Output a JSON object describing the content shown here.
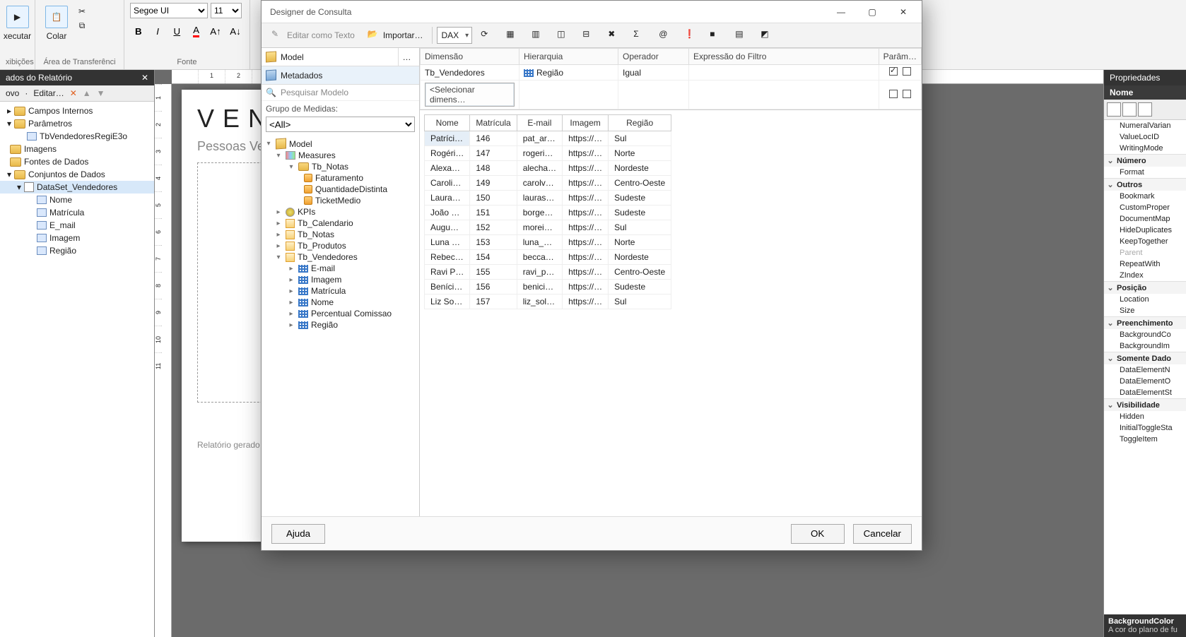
{
  "ribbon": {
    "run_label": "xecutar",
    "paste_label": "Colar",
    "group_views": "xibições",
    "group_clipboard": "Área de Transferênci",
    "group_font": "Fonte",
    "font_name": "Segoe UI",
    "font_size": "11"
  },
  "reportData": {
    "title": "ados do Relatório",
    "action_new": "ovo",
    "action_edit": "Editar…",
    "nodes": {
      "internos": "Campos Internos",
      "params": "Parâmetros",
      "param1": "TbVendedoresRegiE3o",
      "imagens": "Imagens",
      "fontes": "Fontes de Dados",
      "conjuntos": "Conjuntos de Dados",
      "ds": "DataSet_Vendedores",
      "f_nome": "Nome",
      "f_matricula": "Matrícula",
      "f_email": "E_mail",
      "f_imagem": "Imagem",
      "f_regiao": "Região"
    }
  },
  "canvas": {
    "title": "VEN",
    "subtitle": "Pessoas Ve",
    "footer": "Relatório gerado"
  },
  "dialog": {
    "title": "Designer de Consulta",
    "btn_import": "Importar…",
    "btn_editText": "Editar como Texto",
    "dax": "DAX",
    "model": "Model",
    "metadados": "Metadados",
    "search_placeholder": "Pesquisar Modelo",
    "group_label": "Grupo de Medidas:",
    "group_all": "<All>",
    "help": "Ajuda",
    "ok": "OK",
    "cancel": "Cancelar",
    "tree": {
      "model": "Model",
      "measures": "Measures",
      "tb_notas": "Tb_Notas",
      "faturamento": "Faturamento",
      "qtd": "QuantidadeDistinta",
      "ticket": "TicketMedio",
      "kpis": "KPIs",
      "tb_cal": "Tb_Calendario",
      "tb_notas2": "Tb_Notas",
      "tb_prod": "Tb_Produtos",
      "tb_vend": "Tb_Vendedores",
      "email": "E-mail",
      "imagem": "Imagem",
      "matricula": "Matrícula",
      "nome": "Nome",
      "perc": "Percentual Comissao",
      "regiao": "Região"
    },
    "filter": {
      "h_dim": "Dimensão",
      "h_hier": "Hierarquia",
      "h_op": "Operador",
      "h_expr": "Expressão do Filtro",
      "h_param": "Parâm…",
      "r1_dim": "Tb_Vendedores",
      "r1_hier": "Região",
      "r1_op": "Igual",
      "r2_sel": "<Selecionar dimens…"
    },
    "grid": {
      "h_nome": "Nome",
      "h_mat": "Matrícula",
      "h_email": "E-mail",
      "h_img": "Imagem",
      "h_reg": "Região",
      "rows": [
        {
          "nome": "Patríci…",
          "mat": "146",
          "email": "pat_ar…",
          "img": "https://…",
          "reg": "Sul"
        },
        {
          "nome": "Rogéri…",
          "mat": "147",
          "email": "rogeri…",
          "img": "https://…",
          "reg": "Norte"
        },
        {
          "nome": "Alexa…",
          "mat": "148",
          "email": "alecha…",
          "img": "https://…",
          "reg": "Nordeste"
        },
        {
          "nome": "Caroli…",
          "mat": "149",
          "email": "carolv…",
          "img": "https://…",
          "reg": "Centro-Oeste"
        },
        {
          "nome": "Laura…",
          "mat": "150",
          "email": "lauras…",
          "img": "https://…",
          "reg": "Sudeste"
        },
        {
          "nome": "João …",
          "mat": "151",
          "email": "borge…",
          "img": "https://…",
          "reg": "Sudeste"
        },
        {
          "nome": "Augu…",
          "mat": "152",
          "email": "morei…",
          "img": "https://…",
          "reg": "Sul"
        },
        {
          "nome": "Luna …",
          "mat": "153",
          "email": "luna_…",
          "img": "https://…",
          "reg": "Norte"
        },
        {
          "nome": "Rebec…",
          "mat": "154",
          "email": "becca…",
          "img": "https://…",
          "reg": "Nordeste"
        },
        {
          "nome": "Ravi P…",
          "mat": "155",
          "email": "ravi_p…",
          "img": "https://…",
          "reg": "Centro-Oeste"
        },
        {
          "nome": "Beníci…",
          "mat": "156",
          "email": "benici…",
          "img": "https://…",
          "reg": "Sudeste"
        },
        {
          "nome": "Liz So…",
          "mat": "157",
          "email": "liz_sol…",
          "img": "https://…",
          "reg": "Sul"
        }
      ]
    }
  },
  "props": {
    "title": "Propriedades",
    "sect_nome": "Nome",
    "cats": {
      "numero": "Número",
      "outros": "Outros",
      "posicao": "Posição",
      "preench": "Preenchimento",
      "somente": "Somente Dado",
      "visib": "Visibilidade"
    },
    "items": {
      "numeral": "NumeralVarian",
      "valueloc": "ValueLocID",
      "writing": "WritingMode",
      "format": "Format",
      "bookmark": "Bookmark",
      "customprop": "CustomProper",
      "docmap": "DocumentMap",
      "hidedup": "HideDuplicates",
      "keep": "KeepTogether",
      "parent": "Parent",
      "repeat": "RepeatWith",
      "zindex": "ZIndex",
      "location": "Location",
      "size": "Size",
      "bgcolor": "BackgroundCo",
      "bgimg": "BackgroundIm",
      "dename": "DataElementN",
      "deout": "DataElementO",
      "dest": "DataElementSt",
      "hidden": "Hidden",
      "toggle": "InitialToggleSta",
      "toggleitem": "ToggleItem"
    },
    "ftr_title": "BackgroundColor",
    "ftr_desc": "A cor do plano de fu"
  }
}
